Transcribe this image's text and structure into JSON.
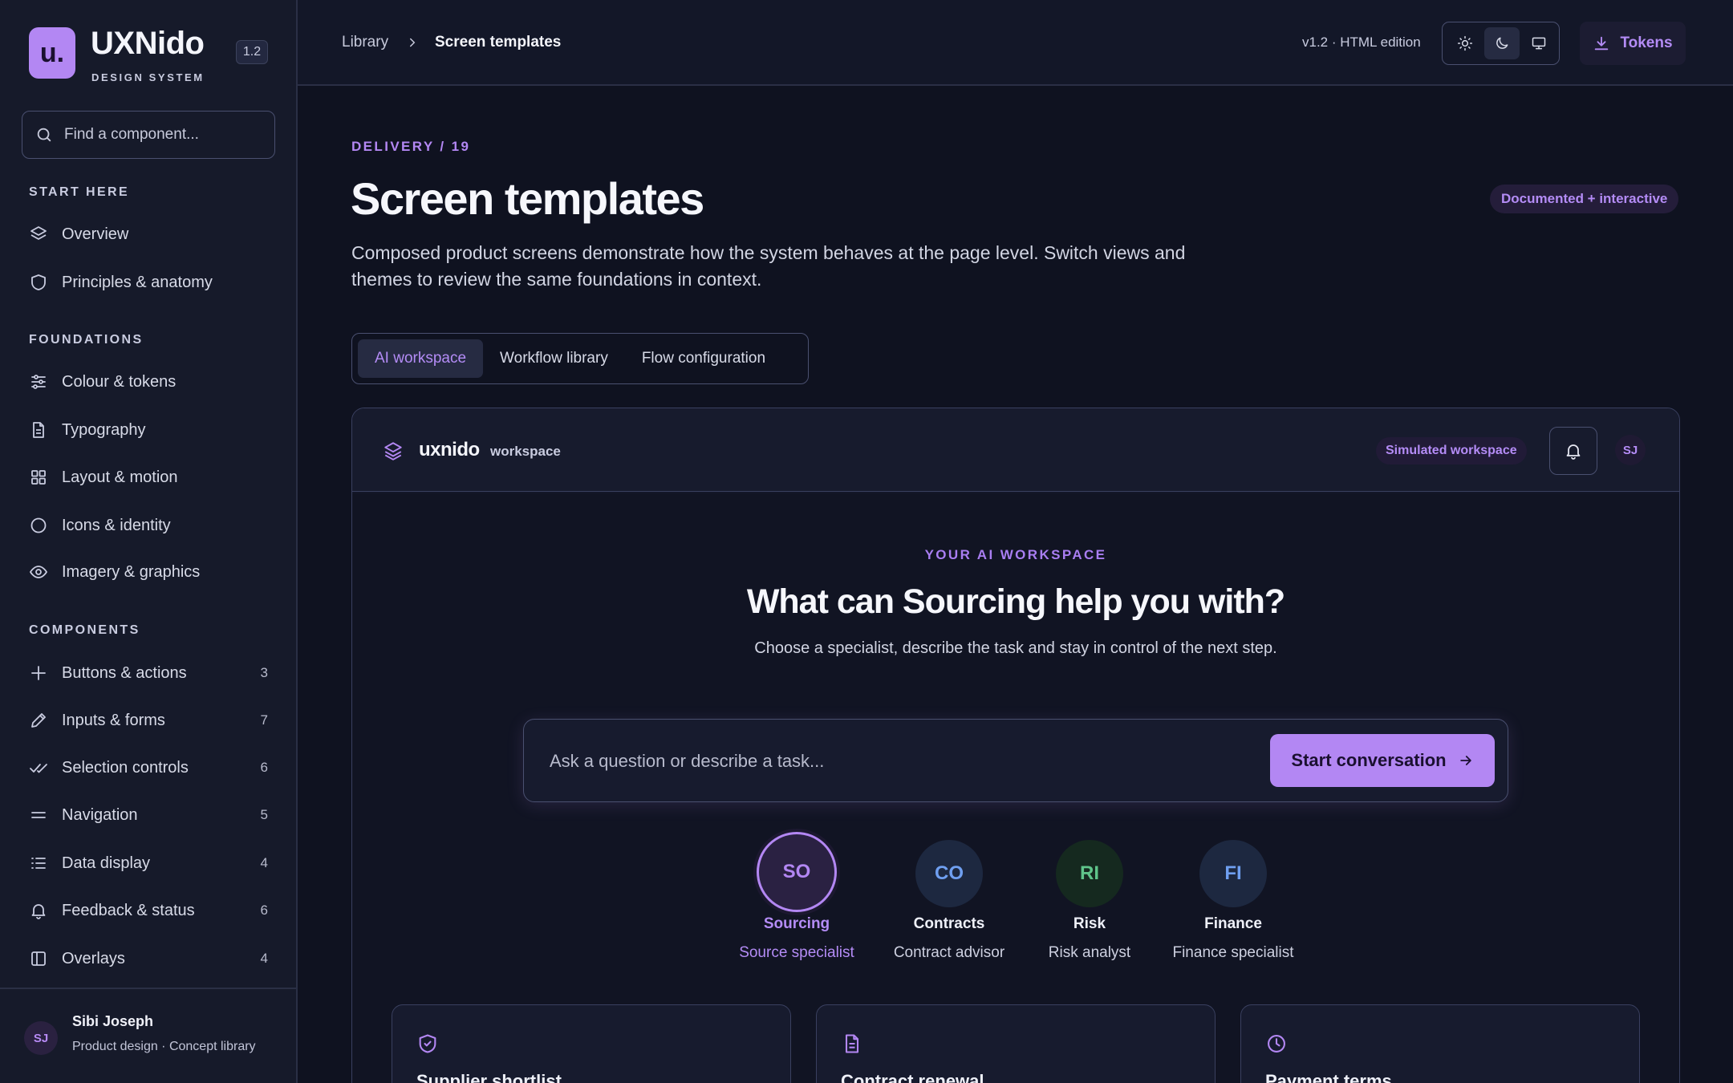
{
  "brand": {
    "logo_text": "u.",
    "name": "UXNido",
    "subtitle": "DESIGN SYSTEM",
    "version": "1.2"
  },
  "search": {
    "placeholder": "Find a component..."
  },
  "sidebar": {
    "sections": [
      {
        "title": "START HERE",
        "items": [
          {
            "label": "Overview",
            "icon": "layers-icon"
          },
          {
            "label": "Principles & anatomy",
            "icon": "shield-icon"
          }
        ]
      },
      {
        "title": "FOUNDATIONS",
        "items": [
          {
            "label": "Colour & tokens",
            "icon": "sliders-icon"
          },
          {
            "label": "Typography",
            "icon": "document-icon"
          },
          {
            "label": "Layout & motion",
            "icon": "grid-icon"
          },
          {
            "label": "Icons & identity",
            "icon": "circle-icon"
          },
          {
            "label": "Imagery & graphics",
            "icon": "eye-icon"
          }
        ]
      },
      {
        "title": "COMPONENTS",
        "items": [
          {
            "label": "Buttons & actions",
            "icon": "plus-icon",
            "count": "3"
          },
          {
            "label": "Inputs & forms",
            "icon": "pencil-icon",
            "count": "7"
          },
          {
            "label": "Selection controls",
            "icon": "double-check-icon",
            "count": "6"
          },
          {
            "label": "Navigation",
            "icon": "menu-icon",
            "count": "5"
          },
          {
            "label": "Data display",
            "icon": "list-icon",
            "count": "4"
          },
          {
            "label": "Feedback & status",
            "icon": "bell-icon",
            "count": "6"
          },
          {
            "label": "Overlays",
            "icon": "panel-icon",
            "count": "4"
          }
        ]
      }
    ]
  },
  "profile": {
    "initials": "SJ",
    "name": "Sibi Joseph",
    "role": "Product design · Concept library"
  },
  "topbar": {
    "breadcrumb": [
      "Library",
      "Screen templates"
    ],
    "edition": "v1.2 · HTML edition",
    "theme_buttons": [
      "sun-icon",
      "moon-icon",
      "monitor-icon"
    ],
    "theme_active": "moon-icon",
    "tokens_label": "Tokens"
  },
  "page": {
    "eyebrow": "DELIVERY / 19",
    "title": "Screen templates",
    "badge": "Documented + interactive",
    "description": "Composed product screens demonstrate how the system behaves at the page level. Switch views and themes to review the same foundations in context.",
    "tabs": [
      "AI workspace",
      "Workflow library",
      "Flow configuration"
    ],
    "active_tab": "AI workspace"
  },
  "preview": {
    "brand": "uxnido",
    "brand_sub": "workspace",
    "badge": "Simulated workspace",
    "avatar": "SJ",
    "eyebrow": "YOUR AI WORKSPACE",
    "title": "What can Sourcing help you with?",
    "subtitle": "Choose a specialist, describe the task and stay in control of the next step.",
    "composer_placeholder": "Ask a question or describe a task...",
    "start_label": "Start conversation",
    "specialists": [
      {
        "initials": "SO",
        "name": "Sourcing",
        "role": "Source specialist",
        "color": "#b387f3",
        "selected": true
      },
      {
        "initials": "CO",
        "name": "Contracts",
        "role": "Contract advisor",
        "color": "#6f9ff0",
        "selected": false
      },
      {
        "initials": "RI",
        "name": "Risk",
        "role": "Risk analyst",
        "color": "#5fc48a",
        "selected": false
      },
      {
        "initials": "FI",
        "name": "Finance",
        "role": "Finance specialist",
        "color": "#6f9ff0",
        "selected": false
      }
    ],
    "cards": [
      {
        "title": "Supplier shortlist",
        "icon": "shield-icon"
      },
      {
        "title": "Contract renewal",
        "icon": "document-icon"
      },
      {
        "title": "Payment terms",
        "icon": "clock-icon"
      }
    ]
  },
  "colors": {
    "accent": "#b387f3",
    "background": "#0f1220",
    "sidebar": "#161a2a"
  }
}
